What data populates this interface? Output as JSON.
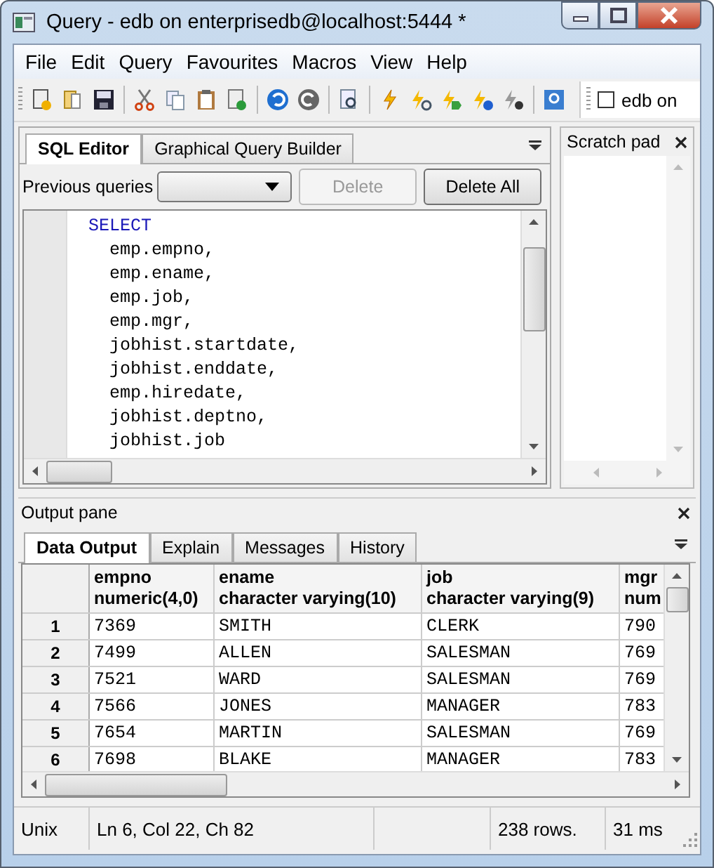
{
  "window": {
    "title": "Query - edb on enterprisedb@localhost:5444 *"
  },
  "menu": [
    "File",
    "Edit",
    "Query",
    "Favourites",
    "Macros",
    "View",
    "Help"
  ],
  "toolbar": {
    "checkbox": {
      "label": "edb on",
      "checked": false
    }
  },
  "editor": {
    "tabs": [
      {
        "label": "SQL Editor",
        "selected": true
      },
      {
        "label": "Graphical Query Builder",
        "selected": false
      }
    ],
    "previous_label": "Previous queries",
    "buttons": [
      {
        "label": "Delete",
        "disabled": true
      },
      {
        "label": "Delete All",
        "disabled": false
      }
    ],
    "lines": [
      {
        "text": "  SELECT",
        "kind": "keyword"
      },
      {
        "text": "    emp.empno,",
        "kind": "plain"
      },
      {
        "text": "    emp.ename,",
        "kind": "plain"
      },
      {
        "text": "    emp.job,",
        "kind": "plain"
      },
      {
        "text": "    emp.mgr,",
        "kind": "plain"
      },
      {
        "text": "    jobhist.startdate,",
        "kind": "plain"
      },
      {
        "text": "    jobhist.enddate,",
        "kind": "plain"
      },
      {
        "text": "    emp.hiredate,",
        "kind": "plain"
      },
      {
        "text": "    jobhist.deptno,",
        "kind": "plain"
      },
      {
        "text": "    jobhist.job",
        "kind": "plain"
      }
    ]
  },
  "scratch_pad": {
    "title": "Scratch pad"
  },
  "output": {
    "title": "Output pane",
    "tabs": [
      {
        "label": "Data Output",
        "selected": true
      },
      {
        "label": "Explain",
        "selected": false
      },
      {
        "label": "Messages",
        "selected": false
      },
      {
        "label": "History",
        "selected": false
      }
    ],
    "columns": [
      {
        "name": "empno",
        "type": "numeric(4,0)"
      },
      {
        "name": "ename",
        "type": "character varying(10)"
      },
      {
        "name": "job",
        "type": "character varying(9)"
      },
      {
        "name": "mgr",
        "type": "num"
      }
    ],
    "rows": [
      {
        "num": "1",
        "cells": [
          "7369",
          "SMITH",
          "CLERK",
          "790"
        ]
      },
      {
        "num": "2",
        "cells": [
          "7499",
          "ALLEN",
          "SALESMAN",
          "769"
        ]
      },
      {
        "num": "3",
        "cells": [
          "7521",
          "WARD",
          "SALESMAN",
          "769"
        ]
      },
      {
        "num": "4",
        "cells": [
          "7566",
          "JONES",
          "MANAGER",
          "783"
        ]
      },
      {
        "num": "5",
        "cells": [
          "7654",
          "MARTIN",
          "SALESMAN",
          "769"
        ]
      },
      {
        "num": "6",
        "cells": [
          "7698",
          "BLAKE",
          "MANAGER",
          "783"
        ]
      }
    ]
  },
  "status_bar": {
    "format": "Unix",
    "position": "Ln 6, Col 22, Ch 82",
    "rows": "238 rows.",
    "time": "31 ms"
  }
}
